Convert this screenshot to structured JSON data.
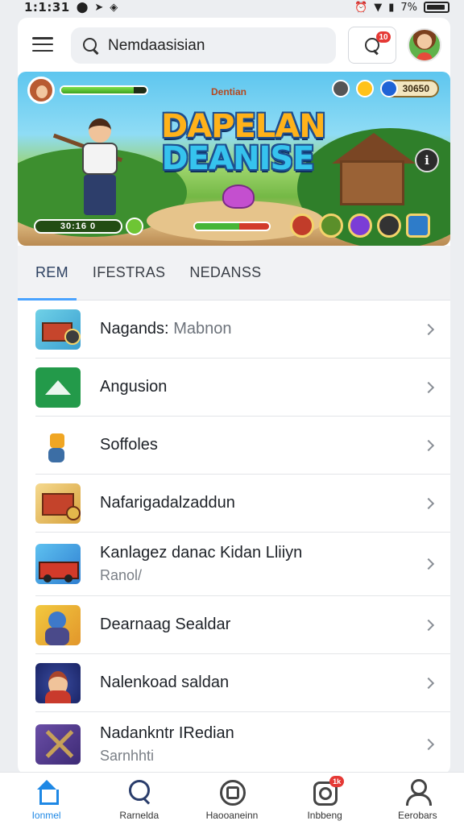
{
  "status_bar": {
    "time": "1:1:31",
    "battery_text": "7%"
  },
  "header": {
    "search_value": "Nemdaasisian",
    "notification_count": "10"
  },
  "banner": {
    "game_title_small": "Dentian",
    "logo_line1": "DAPELAN",
    "logo_line2": "DEANISE",
    "score": "30650",
    "hp_fraction": 0.85,
    "bottom_bar_text": "30:16 0",
    "mid_bar_fraction": 0.6
  },
  "tabs": [
    {
      "label": "REM",
      "active": true
    },
    {
      "label": "IFESTRAS",
      "active": false
    },
    {
      "label": "NEDANSS",
      "active": false
    }
  ],
  "list": [
    {
      "title": "Nagands:",
      "title_muted": "Mabnon",
      "sub": "",
      "icon": "shop-icon"
    },
    {
      "title": "Angusion",
      "title_muted": "",
      "sub": "",
      "icon": "mountain-icon"
    },
    {
      "title": "Soffoles",
      "title_muted": "",
      "sub": "",
      "icon": "knight-icon"
    },
    {
      "title": "Nafarigadalzaddun",
      "title_muted": "",
      "sub": "",
      "icon": "treasure-icon"
    },
    {
      "title": "Kanlagez danac Kidan Lliiyn",
      "title_muted": "",
      "sub": "Ranol/",
      "icon": "truck-icon"
    },
    {
      "title": "Dearnaag Sealdar",
      "title_muted": "",
      "sub": "",
      "icon": "warrior-icon"
    },
    {
      "title": "Nalenkoad saldan",
      "title_muted": "",
      "sub": "",
      "icon": "hero-icon"
    },
    {
      "title": "Nadankntr IRedian",
      "title_muted": "",
      "sub": "Sarnhhti",
      "icon": "sword-icon"
    }
  ],
  "bottom_nav": [
    {
      "label": "Ionmel",
      "icon": "home-icon",
      "active": true
    },
    {
      "label": "Rarnelda",
      "icon": "search-icon",
      "active": false
    },
    {
      "label": "Haooaneinn",
      "icon": "community-icon",
      "active": false
    },
    {
      "label": "Inbbeng",
      "icon": "messages-icon",
      "active": false,
      "badge": "1k"
    },
    {
      "label": "Eerobars",
      "icon": "profile-icon",
      "active": false
    }
  ]
}
